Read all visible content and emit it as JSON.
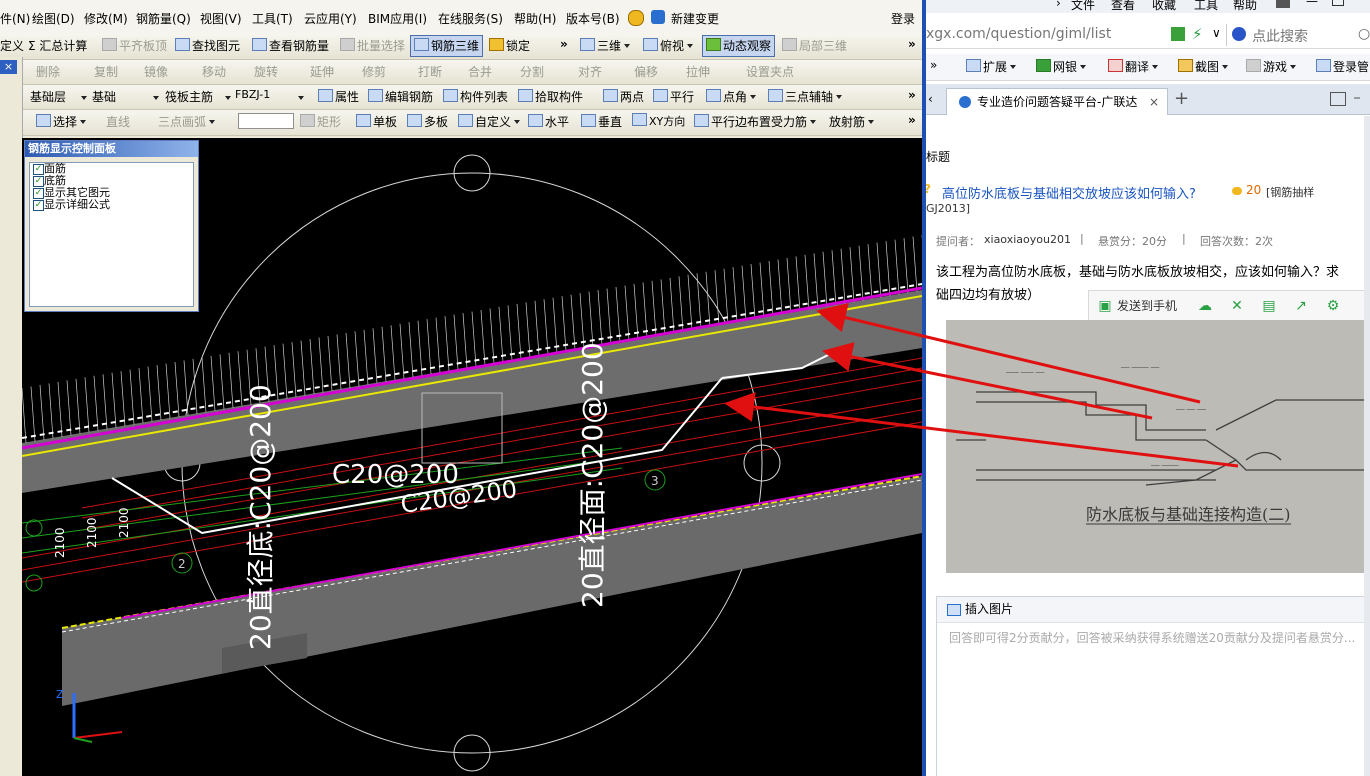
{
  "cad": {
    "menu": [
      "件(N)",
      "绘图(D)",
      "修改(M)",
      "钢筋量(Q)",
      "视图(V)",
      "工具(T)",
      "云应用(Y)",
      "BIM应用(I)",
      "在线服务(S)",
      "帮助(H)",
      "版本号(B)",
      "新建变更",
      "登录"
    ],
    "toolbar1": [
      "定义",
      "Σ 汇总计算",
      "平齐板顶",
      "查找图元",
      "查看钢筋量",
      "批量选择",
      "钢筋三维",
      "锁定",
      "三维",
      "俯视",
      "动态观察",
      "局部三维"
    ],
    "toolbar2": [
      "删除",
      "复制",
      "镜像",
      "移动",
      "旋转",
      "延伸",
      "修剪",
      "打断",
      "合并",
      "分割",
      "对齐",
      "偏移",
      "拉伸",
      "设置夹点"
    ],
    "toolbar3": {
      "layer": "基础层",
      "category": "基础",
      "subtype": "筏板主筋",
      "name": "FBZJ-1",
      "items": [
        "属性",
        "编辑钢筋",
        "构件列表",
        "拾取构件",
        "两点",
        "平行",
        "点角",
        "三点辅轴"
      ]
    },
    "toolbar4": [
      "选择",
      "直线",
      "三点画弧",
      "矩形",
      "单板",
      "多板",
      "自定义",
      "水平",
      "垂直",
      "XY方向",
      "平行边布置受力筋",
      "放射筋"
    ],
    "panel": {
      "title": "钢筋显示控制面板",
      "options": [
        "面筋",
        "底筋",
        "显示其它图元",
        "显示详细公式"
      ]
    },
    "viewport_labels": {
      "rebar_a": "20直径底:C20@200",
      "rebar_b": "20直径面:C20@200",
      "rebar_c": "C20@200",
      "rebar_d": "C20@200",
      "dim1": "2100",
      "dim2": "2100",
      "dim3": "2100",
      "node2": "2",
      "node3": "3",
      "axis_z": "Z"
    },
    "close_x": "×"
  },
  "browser": {
    "menu": [
      "文件",
      "查看",
      "收藏",
      "工具",
      "帮助"
    ],
    "address": "xgx.com/question/giml/list",
    "search_placeholder": "点此搜索",
    "fav": [
      "扩展",
      "网银",
      "翻译",
      "截图",
      "游戏",
      "登录管"
    ],
    "tab_title": "专业造价问题答疑平台-广联达",
    "section": "标题",
    "question_title": "高位防水底板与基础相交放坡应该如何输入?",
    "bounty": "20",
    "category": "[钢筋抽样",
    "category2": "GJ2013]",
    "asker_label": "提问者：",
    "asker": "xiaoxiaoyou201",
    "reward": "悬赏分：20分",
    "answers": "回答次数：2次",
    "body1": "该工程为高位防水底板，基础与防水底板放坡相交，应该如何输入？求",
    "body2": "础四边均有放坡）",
    "send_to_phone": "发送到手机",
    "insert_image": "插入图片",
    "composer_placeholder": "回答即可得2分贡献分，回答被采纳获得系统赠送20贡献分及提问者悬赏分...",
    "sketch_caption": "防水底板与基础连接构造(二)"
  },
  "colors": {
    "titlebar": "#1e50b4",
    "viewport_bg": "#000000",
    "arrow": "#e01010",
    "rebar_magenta": "#d400d4",
    "rebar_yellow": "#e8e800",
    "link": "#1a55c0"
  }
}
